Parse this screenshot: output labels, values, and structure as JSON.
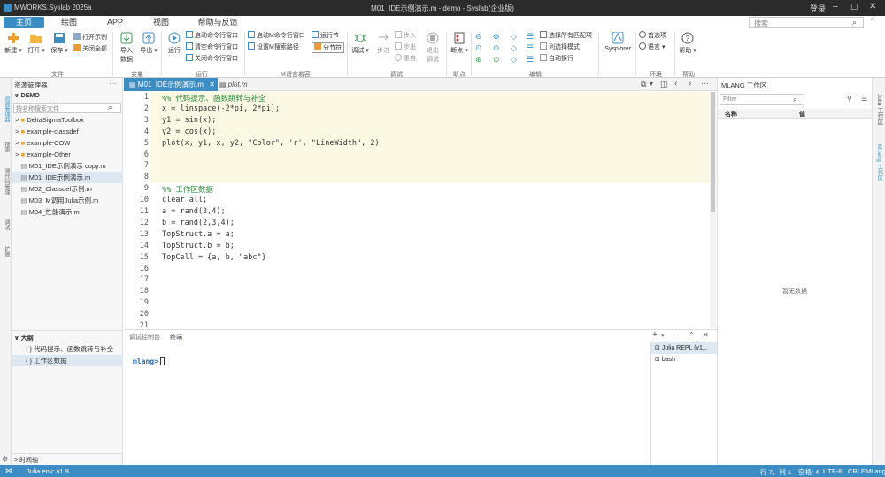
{
  "title": "M01_IDE示例演示.m - demo - Syslab(企业版)",
  "app_name": "MWORKS.Syslab 2025a",
  "login": "登录",
  "menu": [
    "主页",
    "绘图",
    "APP",
    "视图",
    "帮助与反馈"
  ],
  "search_placeholder": "搜索",
  "ribbon": {
    "new": "新建",
    "open": "打开",
    "save": "保存",
    "open_example": "打开示例",
    "close_all": "关闭全部",
    "import": "导入\n数据",
    "export": "导出",
    "run": "运行",
    "start_cmd": "启动命令行窗口",
    "clear_cmd": "清空命令行窗口",
    "close_cmd": "关闭命令行窗口",
    "start_m_cmd": "启动M命令行窗口",
    "set_m_path": "设置M搜索路径",
    "run_section": "运行节",
    "section": "分节符",
    "debug": "调试",
    "step": "步进",
    "step_in": "步入",
    "step_out": "步出",
    "restart": "重启",
    "exit_debug": "退出\n调试",
    "breakpoint": "断点",
    "select_all_matches": "选择所有匹配项",
    "column_select": "列选择模式",
    "auto_wrap": "自动换行",
    "sysplorer": "Sysplorer",
    "prefs": "首选项",
    "language": "语言",
    "help": "帮助",
    "groups": [
      "文件",
      "变量",
      "运行",
      "M语言着容",
      "调试",
      "断点",
      "编辑",
      "环境",
      "帮助"
    ]
  },
  "explorer": {
    "header": "资源管理器",
    "root": "DEMO",
    "filter_placeholder": "按名称搜索文件",
    "items": [
      "DeltaSigmaToolbox",
      "example-classdef",
      "example-COW",
      "example-Other",
      "M01_IDE示例演示 copy.m",
      "M01_IDE示例演示.m",
      "M02_Classdef示例.m",
      "M03_M调用Julia示例.m",
      "M04_性能演示.m"
    ]
  },
  "left_vtabs": [
    "资源管理器",
    "搜索",
    "源代码管理",
    "调试",
    "扩展"
  ],
  "outline": {
    "header": "大纲",
    "items": [
      "{ } 代码提示、函数跳转与补全",
      "{ } 工作区数据"
    ]
  },
  "timeline": "时间轴",
  "tabs": [
    "M01_IDE示例演示.m",
    "plot.m"
  ],
  "code_lines": [
    {
      "n": "1",
      "t": "%% 代码提示、函数跳转与补全"
    },
    {
      "n": "2",
      "t": "x = linspace(-2*pi, 2*pi);"
    },
    {
      "n": "3",
      "t": "y1 = sin(x);"
    },
    {
      "n": "4",
      "t": "y2 = cos(x);"
    },
    {
      "n": "5",
      "t": "plot(x, y1, x, y2, \"Color\", 'r', \"LineWidth\", 2)"
    },
    {
      "n": "6",
      "t": ""
    },
    {
      "n": "7",
      "t": ""
    },
    {
      "n": "8",
      "t": ""
    },
    {
      "n": "9",
      "t": "%% 工作区数据"
    },
    {
      "n": "10",
      "t": "clear all;"
    },
    {
      "n": "11",
      "t": "a = rand(3,4);"
    },
    {
      "n": "12",
      "t": "b = rand(2,3,4);"
    },
    {
      "n": "13",
      "t": "TopStruct.a = a;"
    },
    {
      "n": "14",
      "t": "TopStruct.b = b;"
    },
    {
      "n": "15",
      "t": "TopCell = {a, b, \"abc\"}"
    },
    {
      "n": "16",
      "t": ""
    },
    {
      "n": "17",
      "t": ""
    },
    {
      "n": "18",
      "t": ""
    },
    {
      "n": "19",
      "t": ""
    },
    {
      "n": "20",
      "t": ""
    },
    {
      "n": "21",
      "t": ""
    }
  ],
  "terminal": {
    "tabs": [
      "调试控制台",
      "终端"
    ],
    "prompt": "mlang>",
    "sessions": [
      "Julia REPL (v1...",
      "bash"
    ]
  },
  "workspace": {
    "header": "MLANG 工作区",
    "filter_placeholder": "Filter",
    "col_name": "名称",
    "col_value": "值",
    "empty": "暂无数据"
  },
  "right_vtabs": [
    "Julia 工作区",
    "MLang 工作区"
  ],
  "status": {
    "env": "Julia env: v1.9",
    "pos": "行 7，列 1",
    "spaces": "空格: 4",
    "encoding": "UTF-8",
    "eol": "CRLF",
    "lang": "MLang"
  }
}
